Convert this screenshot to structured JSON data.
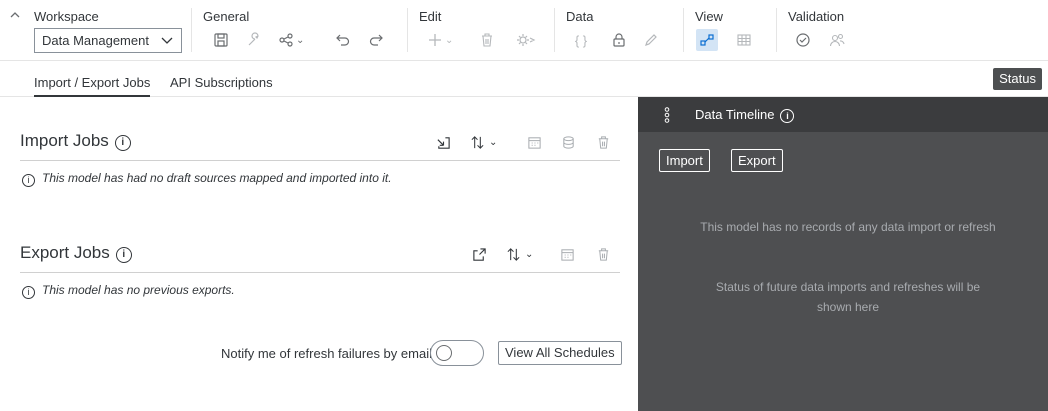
{
  "toolbar": {
    "groups": {
      "workspace": "Workspace",
      "general": "General",
      "edit": "Edit",
      "data": "Data",
      "view": "View",
      "validation": "Validation"
    },
    "workspace_select_value": "Data Management",
    "icons": {
      "collapse": "chevron-up-icon",
      "save": "save-icon",
      "tools": "wrench-icon",
      "share": "share-icon",
      "undo": "undo-icon",
      "redo": "redo-icon",
      "add": "plus-icon",
      "delete": "trash-icon",
      "settings": "gear-icon",
      "formula": "braces-icon",
      "lock": "lock-icon",
      "edit": "pencil-icon",
      "view_graph": "graph-view-icon",
      "view_grid": "grid-view-icon",
      "validate": "check-circle-icon",
      "users": "users-icon"
    }
  },
  "tabs": [
    {
      "label": "Import / Export Jobs",
      "active": true
    },
    {
      "label": "API Subscriptions",
      "active": false
    }
  ],
  "status_button": "Status",
  "import_jobs": {
    "title": "Import Jobs",
    "info_glyph": "i",
    "message": "This model has had no draft sources mapped and imported into it."
  },
  "export_jobs": {
    "title": "Export Jobs",
    "info_glyph": "i",
    "message": "This model has no previous exports."
  },
  "notify": {
    "label": "Notify me of refresh failures by email",
    "toggle_on": false
  },
  "view_all_schedules": "View All Schedules",
  "timeline": {
    "title": "Data Timeline",
    "info_glyph": "i",
    "import_btn": "Import",
    "export_btn": "Export",
    "empty_1": "This model has no records of any data import or refresh",
    "empty_2": "Status of future data imports and refreshes will be shown here"
  },
  "colors": {
    "panel_dark": "#4e4f51",
    "panel_head": "#3b3c3e",
    "accent": "#0a6ed1",
    "status_bg": "#4d4f51"
  }
}
